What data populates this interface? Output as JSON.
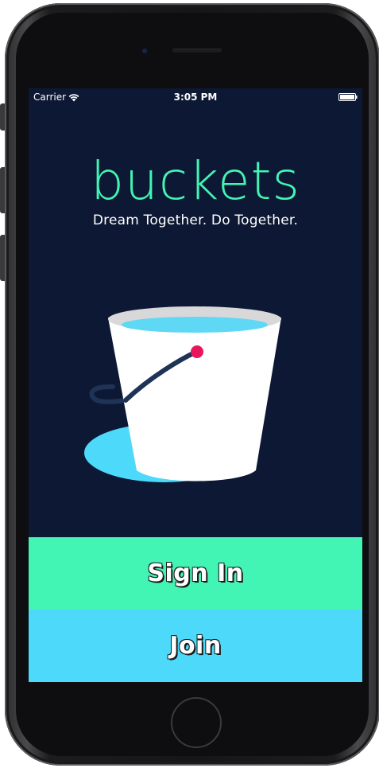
{
  "status_bar": {
    "carrier": "Carrier",
    "time": "3:05 PM",
    "wifi_icon": "wifi-icon",
    "battery_icon": "battery-icon"
  },
  "app": {
    "name": "buckets",
    "tagline": "Dream Together. Do Together.",
    "logo_icon": "bucket-icon"
  },
  "actions": {
    "sign_in_label": "Sign In",
    "join_label": "Join"
  },
  "colors": {
    "background": "#0d1934",
    "brand_green": "#42f5b4",
    "brand_cyan": "#4dd9fa",
    "handle_knob": "#e8175d"
  }
}
